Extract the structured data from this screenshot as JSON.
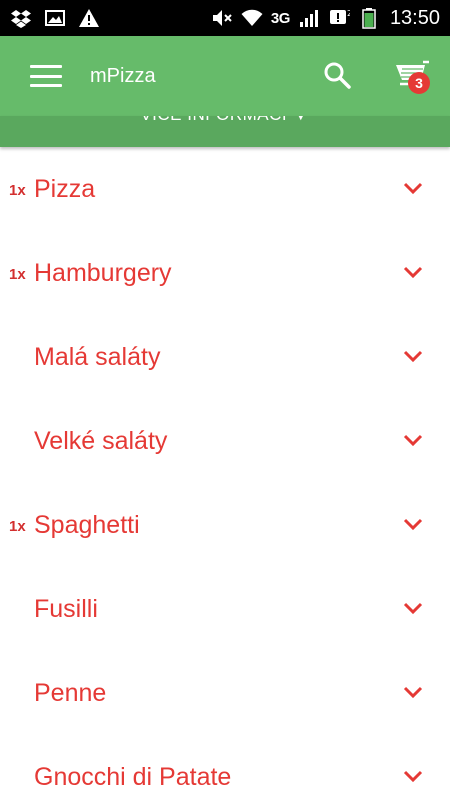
{
  "status_bar": {
    "network": "3G",
    "time": "13:50",
    "icons": [
      "dropbox-icon",
      "image-icon",
      "warning-icon",
      "mute-icon",
      "wifi-icon",
      "signal-icon",
      "notification-icon",
      "battery-icon"
    ]
  },
  "app_bar": {
    "title": "mPizza",
    "cart_count": "3",
    "more_info_label": "VÍCE INFORMACÍ ▼"
  },
  "categories": [
    {
      "qty": "1x",
      "name": "Pizza"
    },
    {
      "qty": "1x",
      "name": "Hamburgery"
    },
    {
      "qty": "",
      "name": "Malá saláty"
    },
    {
      "qty": "",
      "name": "Velké saláty"
    },
    {
      "qty": "1x",
      "name": "Spaghetti"
    },
    {
      "qty": "",
      "name": "Fusilli"
    },
    {
      "qty": "",
      "name": "Penne"
    },
    {
      "qty": "",
      "name": "Gnocchi di Patate"
    }
  ],
  "colors": {
    "app_bar": "#66bb6a",
    "more_info_bar": "#5aa85e",
    "accent_red": "#e53935",
    "status_bar": "#000000"
  }
}
